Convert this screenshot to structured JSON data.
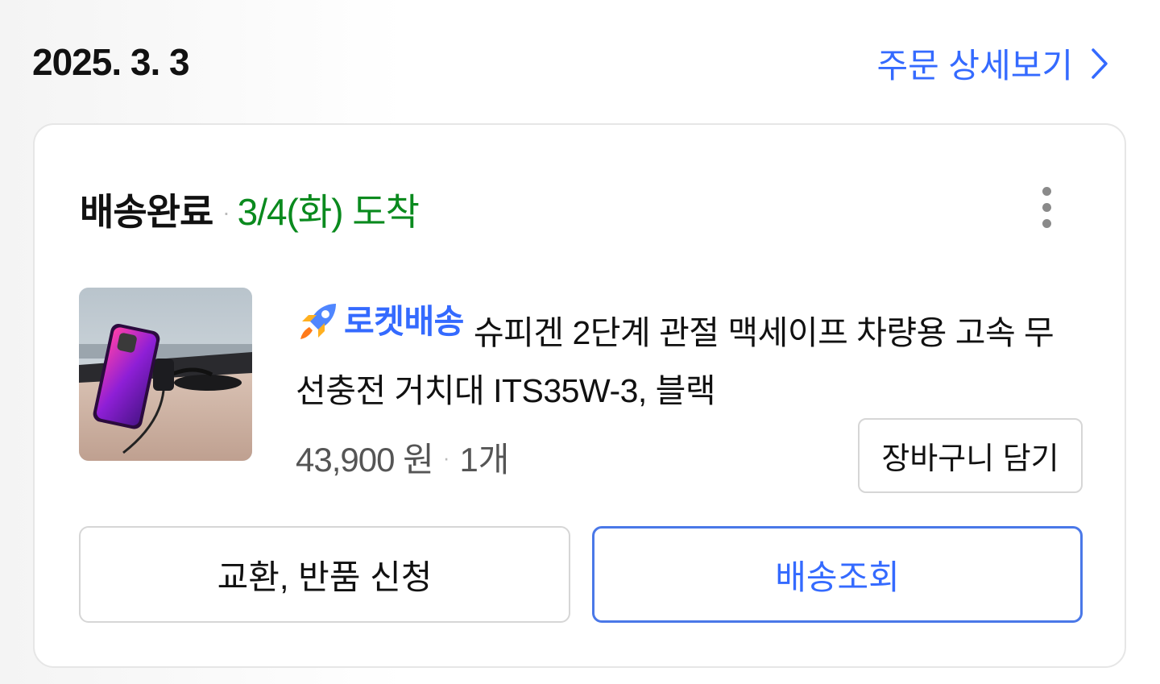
{
  "order": {
    "date": "2025. 3. 3",
    "detail_link_label": "주문 상세보기"
  },
  "shipment": {
    "status": "배송완료",
    "separator": "·",
    "arrival": "3/4(화) 도착"
  },
  "product": {
    "badge_label": "로켓배송",
    "badge_icon": "rocket-icon",
    "name": "슈피겐 2단계 관절 맥세이프 차량용 고속 무선충전 거치대 ITS35W-3, 블랙",
    "price": "43,900 원",
    "quantity": "1개",
    "image_alt": "무선충전 거치대 제품 이미지"
  },
  "actions": {
    "add_to_cart": "장바구니 담기",
    "exchange_return": "교환, 반품 신청",
    "track_delivery": "배송조회"
  },
  "colors": {
    "accent_blue": "#346aff",
    "arrival_green": "#0a8a1e"
  }
}
